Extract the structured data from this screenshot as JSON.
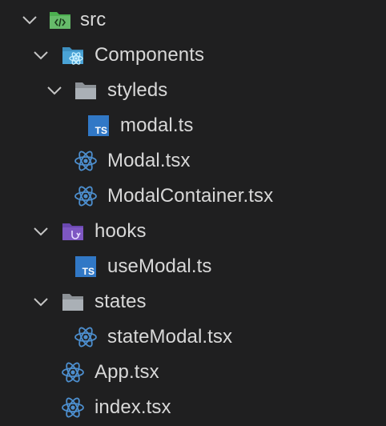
{
  "colors": {
    "background": "#1f1f20",
    "text": "#d8d8d8",
    "chevron": "#c5c5c5",
    "react": "#4d8fcf",
    "ts_badge": "#3178c6",
    "folder_src": "#4caf50",
    "folder_components": "#4aa3d6",
    "folder_hooks": "#7e57c2",
    "folder_generic": "#9aa0a6"
  },
  "tree": {
    "src": {
      "label": "src",
      "icon": "folder-src-icon",
      "expanded": true
    },
    "components": {
      "label": "Components",
      "icon": "folder-components-icon",
      "expanded": true
    },
    "styleds": {
      "label": "styleds",
      "icon": "folder-open-icon",
      "expanded": true
    },
    "modal_ts": {
      "label": "modal.ts",
      "icon": "typescript-icon",
      "badge": "TS"
    },
    "modal_tsx": {
      "label": "Modal.tsx",
      "icon": "react-icon"
    },
    "modal_container_tsx": {
      "label": "ModalContainer.tsx",
      "icon": "react-icon"
    },
    "hooks": {
      "label": "hooks",
      "icon": "folder-hooks-icon",
      "expanded": true
    },
    "use_modal_ts": {
      "label": "useModal.ts",
      "icon": "typescript-icon",
      "badge": "TS"
    },
    "states": {
      "label": "states",
      "icon": "folder-open-icon",
      "expanded": true
    },
    "state_modal_tsx": {
      "label": "stateModal.tsx",
      "icon": "react-icon"
    },
    "app_tsx": {
      "label": "App.tsx",
      "icon": "react-icon"
    },
    "index_tsx": {
      "label": "index.tsx",
      "icon": "react-icon"
    }
  }
}
